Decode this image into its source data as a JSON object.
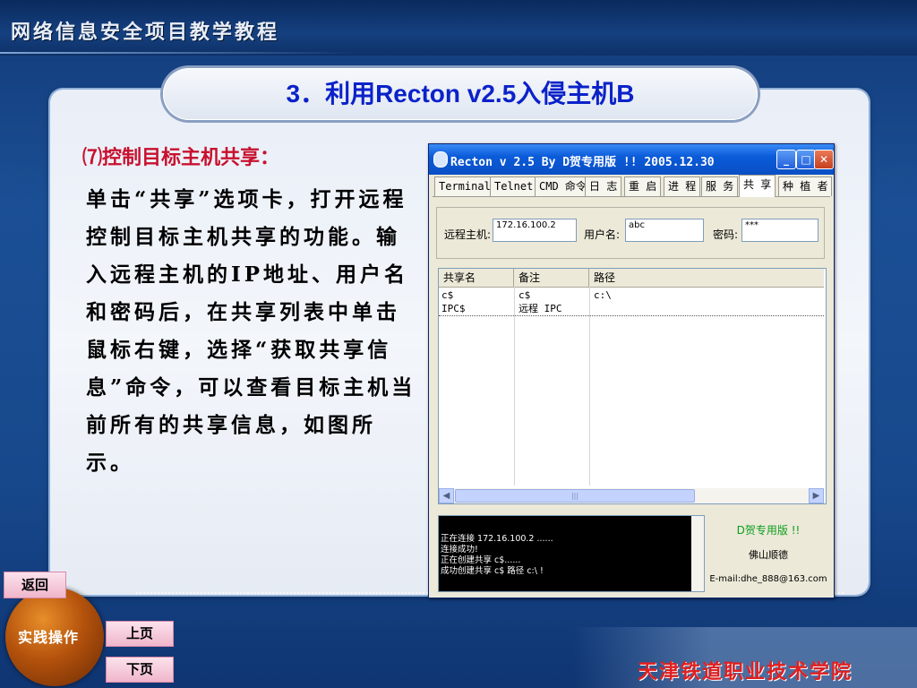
{
  "header": {
    "title": "网络信息安全项目教学教程"
  },
  "slide": {
    "title": "3．利用Recton v2.5入侵主机B",
    "subheading": "⑺控制目标主机共享：",
    "body": "单击“共享”选项卡，打开远程控制目标主机共享的功能。输入远程主机的IP地址、用户名和密码后，在共享列表中单击鼠标右键，选择“获取共享信息”命令，可以查看目标主机当前所有的共享信息，如图所示。"
  },
  "window": {
    "title": "Recton v 2.5  By  D贺专用版 !!  2005.12.30",
    "tabs": [
      "Terminal",
      "Telnet",
      "CMD 命令",
      "日 志",
      "重 启",
      "进 程",
      "服 务",
      "共 享",
      "种 植 者"
    ],
    "active_tab": "共 享",
    "form": {
      "host_label": "远程主机:",
      "host_value": "172.16.100.2",
      "user_label": "用户名:",
      "user_value": "abc",
      "pass_label": "密码:",
      "pass_value": "***"
    },
    "list": {
      "columns": [
        "共享名",
        "备注",
        "路径"
      ],
      "rows": [
        {
          "name": "c$",
          "remark": "c$",
          "path": "c:\\"
        },
        {
          "name": "IPC$",
          "remark": "远程 IPC",
          "path": ""
        }
      ]
    },
    "console_lines": [
      "正在连接 172.16.100.2 ......",
      "连接成功!",
      "正在创建共享 c$......",
      "成功创建共享 c$ 路径 c:\\ !"
    ],
    "brand": {
      "line1": "D贺专用版 !!",
      "line2": "佛山顺德",
      "line3": "E-mail:dhe_888@163.com"
    }
  },
  "nav": {
    "back": "返回",
    "section": "实践操作",
    "prev": "上页",
    "next": "下页"
  },
  "footer": {
    "school": "天津铁道职业技术学院"
  }
}
